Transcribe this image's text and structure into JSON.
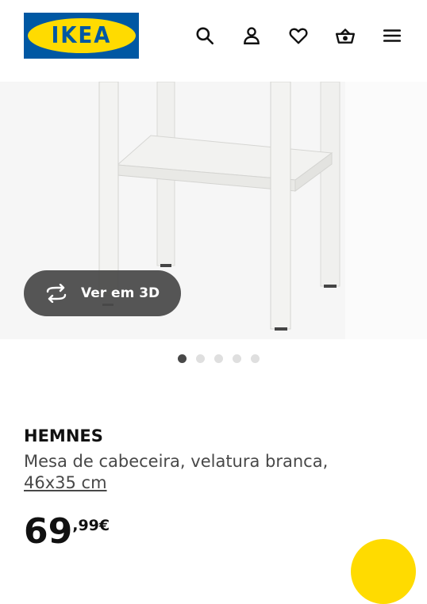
{
  "header": {
    "logo_text": "IKEA",
    "icons": [
      "search-icon",
      "user-icon",
      "heart-icon",
      "basket-icon",
      "menu-icon"
    ]
  },
  "gallery": {
    "view3d_label": "Ver em 3D",
    "slide_count": 5,
    "active_slide": 1
  },
  "product": {
    "name": "HEMNES",
    "description": "Mesa de cabeceira, velatura branca,",
    "size": "46x35 cm",
    "price_integer": "69",
    "price_decimal": ",99€"
  },
  "colors": {
    "ikea_blue": "#0058a3",
    "ikea_yellow": "#ffdb00",
    "button_dark": "#484848"
  }
}
